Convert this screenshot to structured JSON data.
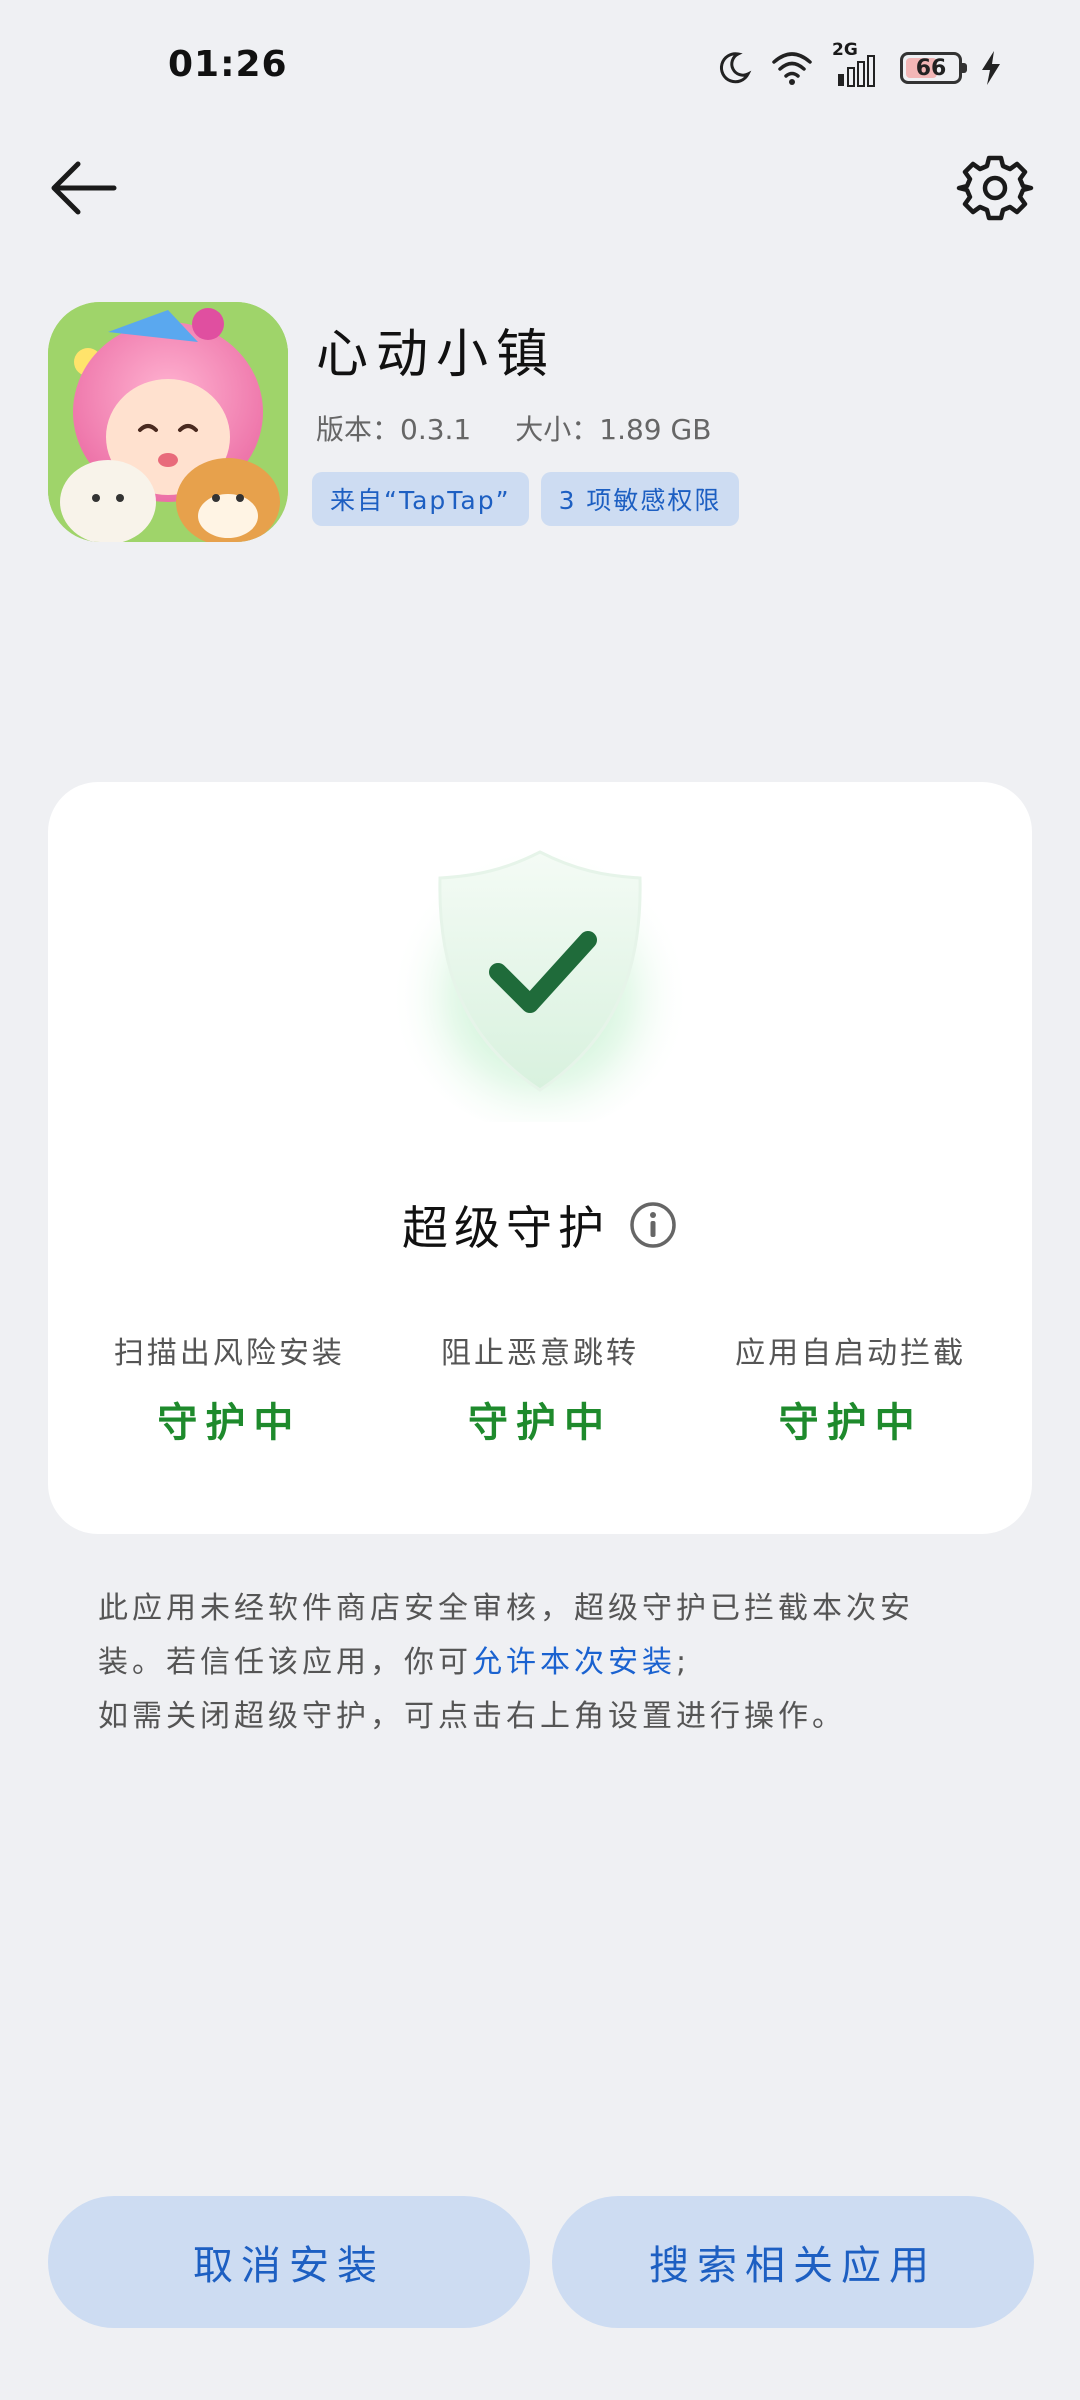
{
  "status_bar": {
    "time": "01:26",
    "network": "2G",
    "battery": "66",
    "battery_level": 0.66
  },
  "app": {
    "name": "心动小镇",
    "version_label": "版本：0.3.1",
    "size_label": "大小：1.89 GB",
    "source_chip": "来自“TapTap”",
    "permissions_chip": "3 项敏感权限"
  },
  "protection": {
    "title": "超级守护",
    "features": [
      {
        "label": "扫描出风险安装",
        "status": "守护中"
      },
      {
        "label": "阻止恶意跳转",
        "status": "守护中"
      },
      {
        "label": "应用自启动拦截",
        "status": "守护中"
      }
    ]
  },
  "description": {
    "line1": "此应用未经软件商店安全审核，超级守护已拦截本次安",
    "line2_prefix": "装。若信任该应用，你可",
    "line2_link": "允许本次安装",
    "line2_suffix": ";",
    "line3": "如需关闭超级守护，可点击右上角设置进行操作。"
  },
  "buttons": {
    "cancel": "取消安装",
    "search": "搜索相关应用"
  },
  "colors": {
    "background": "#eff0f3",
    "accent": "#1d5fc2",
    "chip_bg": "#cddcf2",
    "status_green": "#1e8a2c"
  },
  "icons": {
    "back": "back-arrow-icon",
    "settings": "gear-icon",
    "shield": "shield-check-icon",
    "info": "info-icon"
  }
}
